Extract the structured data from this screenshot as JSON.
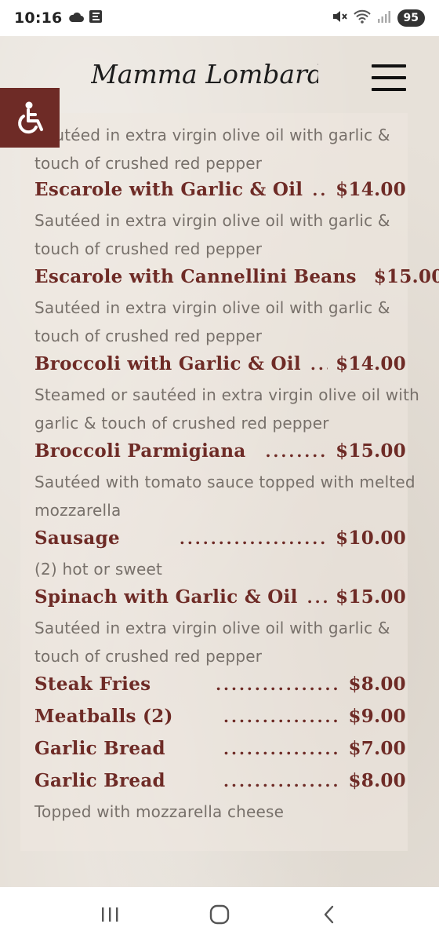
{
  "status": {
    "time": "10:16",
    "battery": "95",
    "left_icons": [
      "cloud-icon",
      "app-e-icon"
    ],
    "right_icons": [
      "mute-icon",
      "wifi-icon",
      "signal-icon"
    ]
  },
  "header": {
    "logo_text": "Mamma Lombardi's",
    "menu_icon": "hamburger-icon",
    "accessibility_icon": "wheelchair-icon"
  },
  "menu": {
    "top_partial_desc": [
      "Sautéed in extra virgin olive oil with garlic &",
      "touch of crushed red pepper"
    ],
    "items": [
      {
        "name": "Escarole with Garlic & Oil",
        "dots": "....",
        "price": "$14.00",
        "desc": [
          "Sautéed in extra virgin olive oil with garlic &",
          "touch of crushed red pepper"
        ]
      },
      {
        "name": "Escarole with Cannellini Beans",
        "dots": "",
        "price": "$15.00",
        "desc": [
          "Sautéed in extra virgin olive oil with garlic &",
          "touch of crushed red pepper"
        ]
      },
      {
        "name": "Broccoli with Garlic & Oil",
        "dots": "....",
        "price": "$14.00",
        "desc": [
          "Steamed or sautéed in extra virgin olive oil with",
          "garlic & touch of crushed red pepper"
        ]
      },
      {
        "name": "Broccoli Parmigiana",
        "dots": "........",
        "price": "$15.00",
        "desc": [
          "Sautéed with tomato sauce topped with melted",
          "mozzarella"
        ]
      },
      {
        "name": "Sausage",
        "dots": "...................",
        "price": "$10.00",
        "desc": [
          "(2) hot or sweet"
        ]
      },
      {
        "name": "Spinach with Garlic & Oil",
        "dots": ".....",
        "price": "$15.00",
        "desc": [
          "Sautéed in extra virgin olive oil with garlic &",
          "touch of crushed red pepper"
        ]
      },
      {
        "name": "Steak Fries",
        "dots": "................",
        "price": "$8.00",
        "desc": []
      },
      {
        "name": "Meatballs (2)",
        "dots": "...............",
        "price": "$9.00",
        "desc": []
      },
      {
        "name": "Garlic Bread",
        "dots": "...............",
        "price": "$7.00",
        "desc": []
      },
      {
        "name": "Garlic Bread",
        "dots": "...............",
        "price": "$8.00",
        "desc": [
          "Topped with mozzarella cheese"
        ]
      }
    ]
  },
  "nav": {
    "recents_icon": "recents-icon",
    "home_icon": "home-icon",
    "back_icon": "back-icon"
  },
  "colors": {
    "accent": "#6e2b26",
    "description": "#77706a",
    "background": "#e7e1d9"
  }
}
